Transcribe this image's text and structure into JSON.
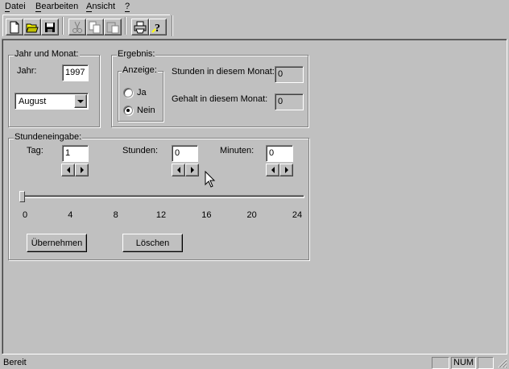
{
  "menubar": {
    "items": [
      {
        "label": "Datei",
        "accel": "D"
      },
      {
        "label": "Bearbeiten",
        "accel": "B"
      },
      {
        "label": "Ansicht",
        "accel": "A"
      },
      {
        "label": "?",
        "accel": "?"
      }
    ]
  },
  "toolbar": {
    "buttons": [
      "new-file-icon",
      "open-folder-icon",
      "save-icon",
      "cut-icon",
      "copy-icon",
      "paste-icon",
      "print-icon",
      "help-icon"
    ]
  },
  "jahr_monat": {
    "legend": "Jahr und Monat:",
    "jahr_label": "Jahr:",
    "jahr_value": "1997",
    "monat_value": "August"
  },
  "ergebnis": {
    "legend": "Ergebnis:",
    "anzeige_legend": "Anzeige:",
    "radio_ja": "Ja",
    "radio_nein": "Nein",
    "selected": "Nein",
    "stunden_label": "Stunden in diesem Monat:",
    "stunden_value": "0",
    "gehalt_label": "Gehalt in diesem Monat:",
    "gehalt_value": "0"
  },
  "stundeneingabe": {
    "legend": "Stundeneingabe:",
    "tag_label": "Tag:",
    "tag_value": "1",
    "stunden_label": "Stunden:",
    "stunden_value": "0",
    "minuten_label": "Minuten:",
    "minuten_value": "0",
    "slider_value": 0,
    "slider_max": 24,
    "ticks": [
      "0",
      "4",
      "8",
      "12",
      "16",
      "20",
      "24"
    ],
    "uebernehmen": "Übernehmen",
    "loeschen": "Löschen"
  },
  "statusbar": {
    "text": "Bereit",
    "num": "NUM"
  }
}
